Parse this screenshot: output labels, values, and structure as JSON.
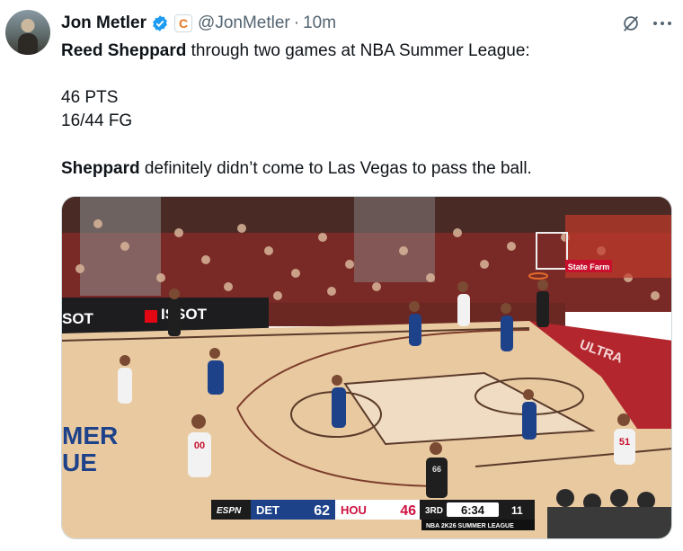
{
  "tweet": {
    "author_name": "Jon Metler",
    "handle": "@JonMetler",
    "separator": "·",
    "time": "10m",
    "badge_letter": "C",
    "icons": [
      "verified-badge-icon",
      "affiliate-badge-icon",
      "grok-icon",
      "more-icon"
    ],
    "line1_bold": "Reed Sheppard",
    "line1_rest": " through two games at NBA Summer League:",
    "stat1": "46 PTS",
    "stat2": "16/44 FG",
    "line3_bold": "Sheppard",
    "line3_rest": " definitely didn’t come to Las Vegas to pass the ball."
  },
  "media": {
    "board_left": "SOT",
    "board_tissot": "ISSOT",
    "court_text1": "MER",
    "court_text2": "UE",
    "ultra_text": "ULTRA",
    "statefarm_text": "State Farm",
    "player_numbers": [
      "00",
      "51",
      "66"
    ],
    "scoreboard": {
      "network": "ESPN",
      "team1": "DET",
      "score1": "62",
      "team2": "HOU",
      "score2": "46",
      "period": "3RD",
      "clock": "6:34",
      "shot_clock": "11",
      "footer": "NBA 2K26 SUMMER LEAGUE"
    },
    "colors": {
      "court_wood": "#e9c9a0",
      "paint": "#f0dcc2",
      "sideline_red": "#b3262e",
      "det_blue": "#1d428a",
      "hou_red": "#ce1141"
    }
  }
}
